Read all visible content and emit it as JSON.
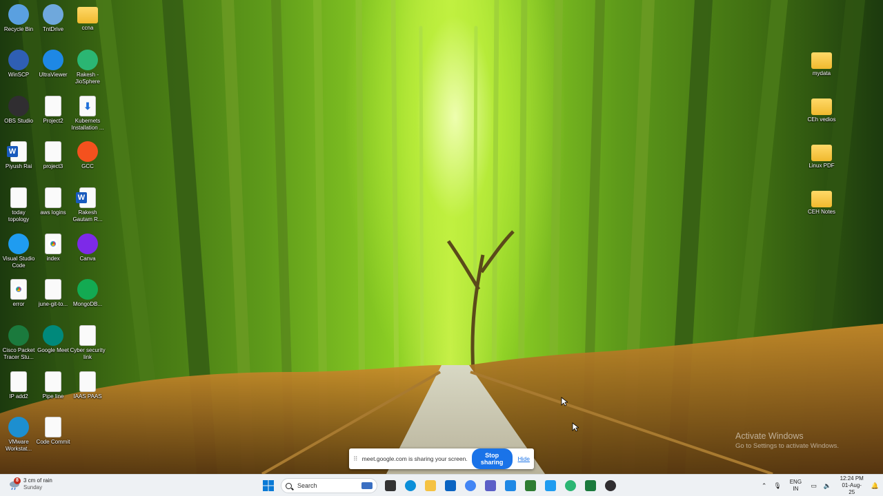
{
  "desktop": {
    "icons_left": [
      {
        "label": "Recycle Bin",
        "icon": "recycle-bin-icon",
        "color": "#5aa0e0"
      },
      {
        "label": "TntDrive",
        "icon": "tntdrive-icon",
        "color": "#6fa8dc"
      },
      {
        "label": "ccna",
        "icon": "folder-icon",
        "color": "#f5c242"
      },
      {
        "label": "WinSCP",
        "icon": "winscp-icon",
        "color": "#2f5fb3"
      },
      {
        "label": "UltraViewer",
        "icon": "ultraviewer-icon",
        "color": "#1e88e5"
      },
      {
        "label": "Rakesh - JioSphere",
        "icon": "jiosphere-icon",
        "color": "#2bb673"
      },
      {
        "label": "OBS Studio",
        "icon": "obs-studio-icon",
        "color": "#302e31"
      },
      {
        "label": "Project2",
        "icon": "document-icon",
        "color": "#fafafa"
      },
      {
        "label": "Kubernets Installation ...",
        "icon": "download-file-icon",
        "color": "#1e6fd9"
      },
      {
        "label": "Piyush Rai",
        "icon": "word-document-icon",
        "color": "#185abd"
      },
      {
        "label": "project3",
        "icon": "document-icon",
        "color": "#fafafa"
      },
      {
        "label": "GCC",
        "icon": "gcc-icon",
        "color": "#f4511e"
      },
      {
        "label": "today topology",
        "icon": "document-icon",
        "color": "#fafafa"
      },
      {
        "label": "aws logins",
        "icon": "document-icon",
        "color": "#fafafa"
      },
      {
        "label": "Rakesh Gautam R...",
        "icon": "word-document-icon",
        "color": "#185abd"
      },
      {
        "label": "Visual Studio Code",
        "icon": "vscode-icon",
        "color": "#1f9cf0"
      },
      {
        "label": "index",
        "icon": "chrome-html-icon",
        "color": "#4285f4"
      },
      {
        "label": "Canva",
        "icon": "canva-icon",
        "color": "#7d2ae8"
      },
      {
        "label": "error",
        "icon": "chrome-html-icon",
        "color": "#4285f4"
      },
      {
        "label": "june-git-to...",
        "icon": "document-icon",
        "color": "#fafafa"
      },
      {
        "label": "MongoDB...",
        "icon": "mongodb-icon",
        "color": "#13aa52"
      },
      {
        "label": "Cisco Packet Tracer Stu...",
        "icon": "packet-tracer-icon",
        "color": "#1b7a3d"
      },
      {
        "label": "Google Meet",
        "icon": "google-meet-icon",
        "color": "#00897b"
      },
      {
        "label": "Cyber security link",
        "icon": "document-icon",
        "color": "#fafafa"
      },
      {
        "label": "IP add2",
        "icon": "document-icon",
        "color": "#fafafa"
      },
      {
        "label": "Pipe line",
        "icon": "image-file-icon",
        "color": "#fafafa"
      },
      {
        "label": "IAAS PAAS",
        "icon": "image-file-icon",
        "color": "#fafafa"
      },
      {
        "label": "VMware Workstat...",
        "icon": "vmware-icon",
        "color": "#1d8fd0"
      },
      {
        "label": "Code Commit",
        "icon": "image-file-icon",
        "color": "#fafafa"
      }
    ],
    "icons_right": [
      {
        "label": "mydata",
        "icon": "folder-icon",
        "color": "#f5c242"
      },
      {
        "label": "CEh vedios",
        "icon": "folder-icon",
        "color": "#f5c242"
      },
      {
        "label": "Linux PDF",
        "icon": "folder-icon",
        "color": "#f5c242"
      },
      {
        "label": "CEH Notes",
        "icon": "folder-icon",
        "color": "#f5c242"
      }
    ]
  },
  "watermark": {
    "title": "Activate Windows",
    "subtitle": "Go to Settings to activate Windows."
  },
  "share_bar": {
    "message": "meet.google.com is sharing your screen.",
    "stop_label": "Stop sharing",
    "hide_label": "Hide",
    "accent": "#1a73e8"
  },
  "taskbar": {
    "weather": {
      "badge": "8",
      "line1": "3 cm of rain",
      "line2": "Sunday"
    },
    "search_placeholder": "Search",
    "apps": [
      {
        "name": "task-view",
        "color": "#333333"
      },
      {
        "name": "edge",
        "color": "#0c8fd9"
      },
      {
        "name": "file-explorer",
        "color": "#f5c242"
      },
      {
        "name": "outlook",
        "color": "#0a64c2"
      },
      {
        "name": "chrome",
        "color": "#4285f4"
      },
      {
        "name": "teams",
        "color": "#5b5fc7"
      },
      {
        "name": "store",
        "color": "#1e88e5"
      },
      {
        "name": "network-app",
        "color": "#2e7d32"
      },
      {
        "name": "vscode",
        "color": "#1f9cf0"
      },
      {
        "name": "jiosphere",
        "color": "#2bb673"
      },
      {
        "name": "packet-tracer",
        "color": "#1b7a3d"
      },
      {
        "name": "obs-recording",
        "color": "#302e31"
      }
    ],
    "tray": {
      "lang_line1": "ENG",
      "lang_line2": "IN",
      "time": "12:24 PM",
      "date": "01-Aug-25"
    }
  }
}
